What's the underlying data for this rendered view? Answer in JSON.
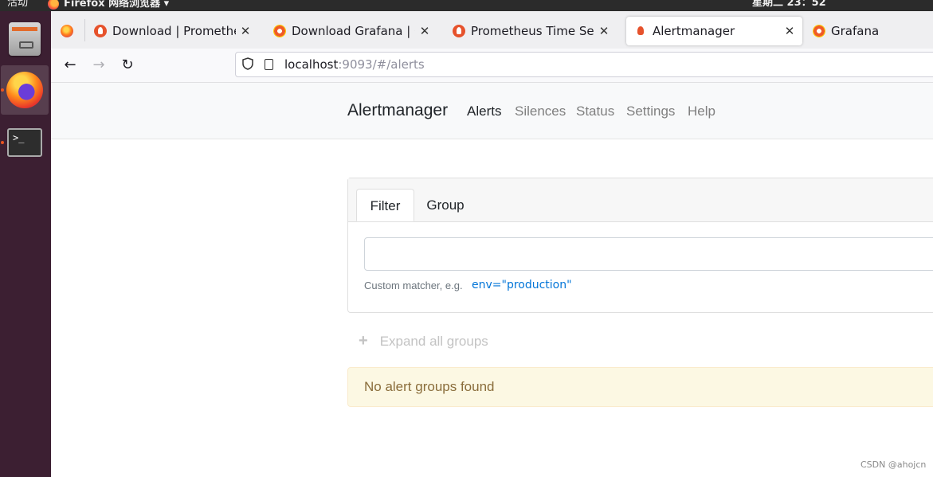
{
  "topbar": {
    "activities": "活动",
    "app_name": "Firefox 网络浏览器 ▾",
    "clock": "星期二 23：52"
  },
  "dock": {
    "items": [
      "files-icon",
      "firefox-icon",
      "terminal-icon"
    ]
  },
  "browser": {
    "tabs": [
      {
        "label": "Download | Prometheus",
        "close": "✕"
      },
      {
        "label": "Download Grafana | Grafana",
        "close": "✕"
      },
      {
        "label": "Prometheus Time Series",
        "close": "✕"
      },
      {
        "label": "Alertmanager",
        "close": "✕"
      },
      {
        "label": "Grafana"
      }
    ],
    "back": "←",
    "forward": "→",
    "reload": "↻",
    "url_host": "localhost",
    "url_rest": ":9093/#/alerts"
  },
  "alertmanager": {
    "brand": "Alertmanager",
    "nav": [
      "Alerts",
      "Silences",
      "Status",
      "Settings",
      "Help"
    ],
    "filter_tabs": [
      "Filter",
      "Group"
    ],
    "filter_value": "",
    "hint": "Custom matcher, e.g.",
    "hint_example": "env=\"production\"",
    "expand": "Expand all groups",
    "expand_icon": "+",
    "no_groups": "No alert groups found"
  },
  "watermark": "CSDN @ahojcn",
  "colors": {
    "link": "#0275d8",
    "warning_bg": "#fcf8e3",
    "warning_text": "#8a6d3b",
    "dock": "#3c1f32"
  }
}
